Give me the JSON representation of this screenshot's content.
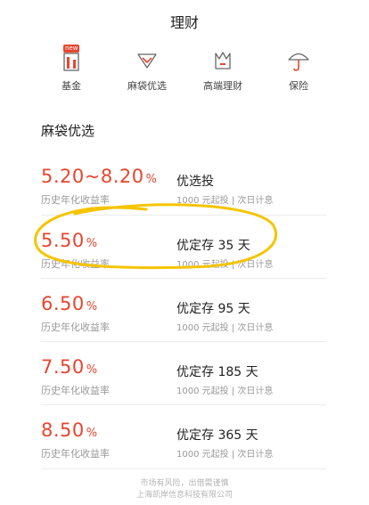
{
  "header": {
    "title": "理财"
  },
  "nav": {
    "badge": "new",
    "items": [
      {
        "label": "基金",
        "icon": "fund-icon"
      },
      {
        "label": "麻袋优选",
        "icon": "diamond-icon"
      },
      {
        "label": "高端理财",
        "icon": "crown-icon"
      },
      {
        "label": "保险",
        "icon": "umbrella-icon"
      }
    ]
  },
  "section": {
    "title": "麻袋优选"
  },
  "products": [
    {
      "rate": "5.20~8.20",
      "pct": "%",
      "rate_label": "历史年化收益率",
      "name": "优选投",
      "note": "1000 元起投 | 次日计息"
    },
    {
      "rate": "5.50",
      "pct": "%",
      "rate_label": "历史年化收益率",
      "name": "优定存 35 天",
      "note": "1000 元起投 | 次日计息"
    },
    {
      "rate": "6.50",
      "pct": "%",
      "rate_label": "历史年化收益率",
      "name": "优定存 95 天",
      "note": "1000 元起投 | 次日计息"
    },
    {
      "rate": "7.50",
      "pct": "%",
      "rate_label": "历史年化收益率",
      "name": "优定存 185 天",
      "note": "1000 元起投 | 次日计息"
    },
    {
      "rate": "8.50",
      "pct": "%",
      "rate_label": "历史年化收益率",
      "name": "优定存 365 天",
      "note": "1000 元起投 | 次日计息"
    }
  ],
  "footer": {
    "line1": "市场有风险，出借需谨慎",
    "line2": "上海凯岸信息科技有限公司"
  },
  "colors": {
    "accent": "#e8452e",
    "highlight": "#f5c400"
  }
}
